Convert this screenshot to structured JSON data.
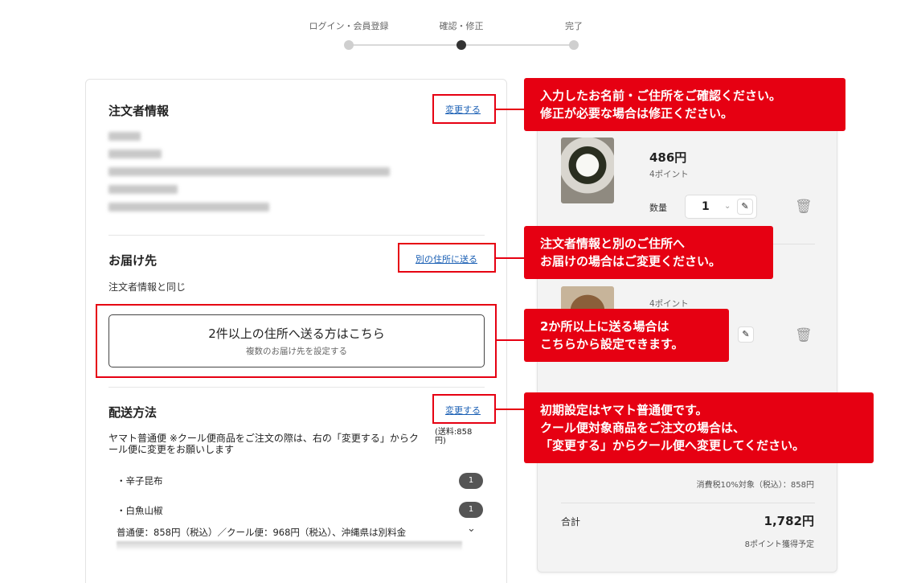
{
  "stepper": {
    "steps": [
      {
        "label": "ログイン・会員登録",
        "active": false
      },
      {
        "label": "確認・修正",
        "active": true
      },
      {
        "label": "完了",
        "active": false
      }
    ]
  },
  "orderer": {
    "title": "注文者情報",
    "change_link": "変更する"
  },
  "delivery": {
    "title": "お届け先",
    "alt_link": "別の住所に送る",
    "same_text": "注文者情報と同じ",
    "multi_button": {
      "main": "2件以上の住所へ送る方はこちら",
      "sub": "複数のお届け先を設定する"
    }
  },
  "shipping": {
    "title": "配送方法",
    "change_link": "変更する",
    "description": "ヤマト普通便 ※クール便商品をご注文の際は、右の「変更する」からクール便に変更をお願いします",
    "fee": "(送料:858円)",
    "items": [
      {
        "name": "・辛子昆布",
        "qty": "1"
      },
      {
        "name": "・白魚山椒",
        "qty": "1"
      }
    ],
    "note": "普通便：858円（税込）／クール便：968円（税込）、沖縄県は別料金"
  },
  "cart": {
    "items": [
      {
        "price": "486円",
        "points": "4ポイント",
        "qty_label": "数量",
        "qty": "1"
      },
      {
        "points": "4ポイント"
      }
    ],
    "tax_target": "消費税10%対象（税込）：858円",
    "total_label": "合計",
    "total_value": "1,782円",
    "total_points": "8ポイント獲得予定"
  },
  "callouts": {
    "name_address": [
      "入力したお名前・ご住所をご確認ください。",
      "修正が必要な場合は修正ください。"
    ],
    "other_address": [
      "注文者情報と別のご住所へ",
      "お届けの場合はご変更ください。"
    ],
    "multi_address": [
      "2か所以上に送る場合は",
      "こちらから設定できます。"
    ],
    "shipping_method": [
      "初期設定はヤマト普通便です。",
      "クール便対象商品をご注文の場合は、",
      "「変更する」からクール便へ変更してください。"
    ]
  },
  "colors": {
    "accent": "#e60012",
    "link": "#1a5fb4"
  }
}
